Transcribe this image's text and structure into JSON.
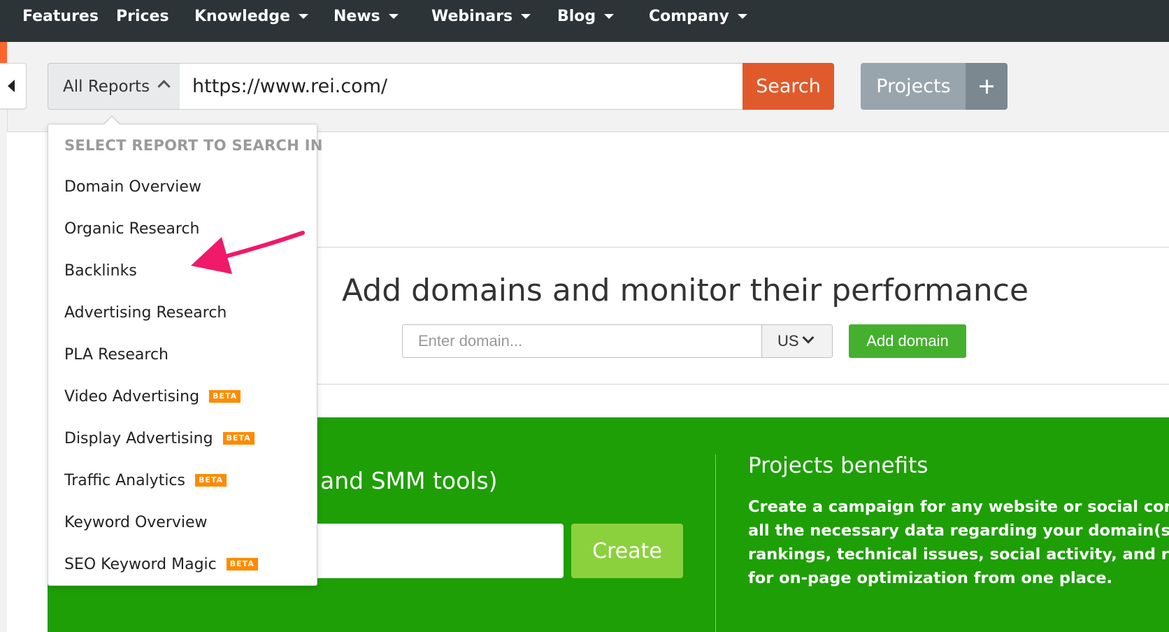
{
  "nav": {
    "items": [
      {
        "label": "Features",
        "dropdown": false
      },
      {
        "label": "Prices",
        "dropdown": false
      },
      {
        "label": "Knowledge",
        "dropdown": true
      },
      {
        "label": "News",
        "dropdown": true
      },
      {
        "label": "Webinars",
        "dropdown": true
      },
      {
        "label": "Blog",
        "dropdown": true
      },
      {
        "label": "Company",
        "dropdown": true
      }
    ]
  },
  "search": {
    "report_select_label": "All Reports",
    "url_value": "https://www.rei.com/",
    "search_button": "Search",
    "projects_button": "Projects"
  },
  "dropdown": {
    "heading": "SELECT REPORT TO SEARCH IN",
    "items": [
      {
        "label": "Domain Overview",
        "beta": ""
      },
      {
        "label": "Organic Research",
        "beta": ""
      },
      {
        "label": "Backlinks",
        "beta": ""
      },
      {
        "label": "Advertising Research",
        "beta": ""
      },
      {
        "label": "PLA Research",
        "beta": ""
      },
      {
        "label": "Video Advertising",
        "beta": "BETA"
      },
      {
        "label": "Display Advertising",
        "beta": "BETA"
      },
      {
        "label": "Traffic Analytics",
        "beta": "BETA"
      },
      {
        "label": "Keyword Overview",
        "beta": ""
      },
      {
        "label": "SEO Keyword Magic",
        "beta": "BETA"
      }
    ]
  },
  "monitor": {
    "title": "Add domains and monitor their performance",
    "domain_placeholder": "Enter domain...",
    "country": "US",
    "add_button": "Add domain"
  },
  "projects": {
    "heading_fragment": "and SMM tools)",
    "create_button": "Create",
    "benefits_title": "Projects benefits",
    "benefits_lines": [
      "Create a campaign for any website or social comm",
      "all the necessary data regarding your domain(s)' k",
      "rankings, technical issues, social activity, and reco",
      "for on-page optimization from one place."
    ]
  },
  "colors": {
    "nav_bg": "#2d3437",
    "search_orange": "#e05a2b",
    "projects_gray": "#99a5ad",
    "add_green": "#45b02e",
    "section_green": "#1e9f06",
    "create_green": "#8bd13d",
    "beta_orange": "#ff8a00",
    "arrow_pink": "#f0196a"
  },
  "icons": {
    "collapse": "triangle-left-icon",
    "select_chevron": "chevron-up-icon",
    "clear": "close-icon",
    "plus": "plus-icon",
    "country_chevron": "chevron-down-icon",
    "annotation": "pink-arrow"
  }
}
